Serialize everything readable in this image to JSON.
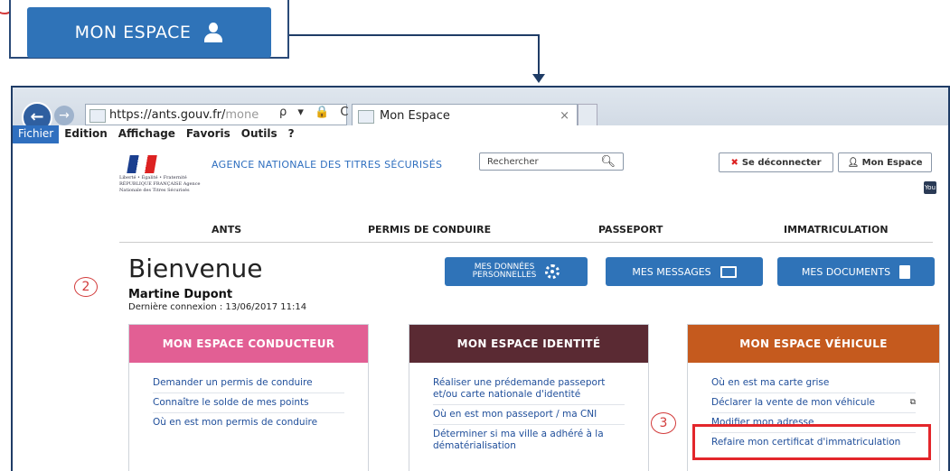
{
  "callout": {
    "button_label": "MON ESPACE"
  },
  "browser": {
    "url_main": "https://ants.gouv.fr/",
    "url_rest": "mone",
    "address_tools": "ρ ▾ 🔒 C",
    "tab_title": "Mon Espace",
    "tab_close": "×",
    "menu": [
      "Fichier",
      "Edition",
      "Affichage",
      "Favoris",
      "Outils",
      "?"
    ]
  },
  "header": {
    "logo_text": "Liberté • Égalité • Fraternité RÉPUBLIQUE FRANÇAISE Agence Nationale des Titres Sécurisés",
    "agency": "AGENCE NATIONALE DES TITRES SÉCURISÉS",
    "search_placeholder": "Rechercher",
    "logout": "Se déconnecter",
    "mon_espace": "Mon Espace",
    "youtube": "You Tube"
  },
  "nav": [
    "ANTS",
    "PERMIS DE CONDUIRE",
    "PASSEPORT",
    "IMMATRICULATION"
  ],
  "welcome": {
    "title": "Bienvenue",
    "user": "Martine Dupont",
    "last_connection": "Dernière connexion : 13/06/2017 11:14",
    "callout_number": "2"
  },
  "actions": {
    "donnees_line1": "MES DONNÉES",
    "donnees_line2": "PERSONNELLES",
    "messages": "MES MESSAGES",
    "documents": "MES DOCUMENTS"
  },
  "cards": [
    {
      "title": "MON ESPACE CONDUCTEUR",
      "color": "#e25f94",
      "links": [
        "Demander un permis de conduire",
        "Connaître le solde de mes points",
        "Où en est mon permis de conduire"
      ]
    },
    {
      "title": "MON ESPACE IDENTITÉ",
      "color": "#5a2a33",
      "links": [
        "Réaliser une prédemande passeport et/ou carte nationale d'identité",
        "Où en est mon passeport / ma CNI",
        "Déterminer si ma ville a adhéré à la dématérialisation"
      ]
    },
    {
      "title": "MON ESPACE VÉHICULE",
      "color": "#c55a1e",
      "links": [
        "Où en est ma carte grise",
        "Déclarer la vente de mon véhicule",
        "Modifier mon adresse",
        "Refaire mon certificat d'immatriculation"
      ],
      "callout_number": "3"
    }
  ],
  "colors": {
    "primary_blue": "#2f73b8",
    "annotation_red": "#e3262b"
  }
}
